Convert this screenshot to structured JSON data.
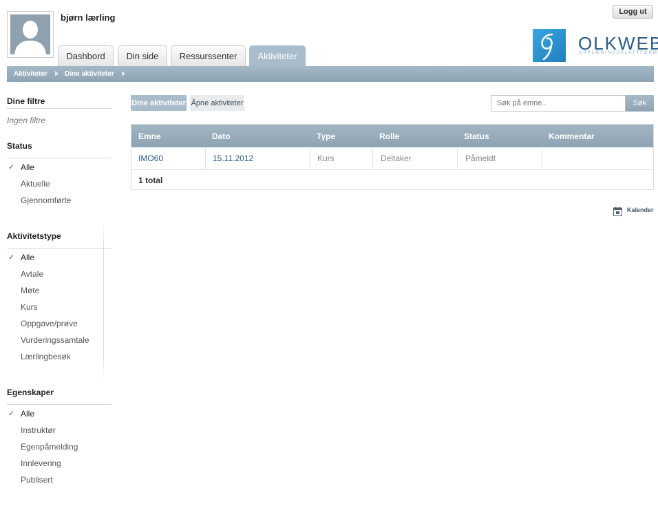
{
  "header": {
    "username": "bjørn lærling",
    "logout_label": "Logg ut",
    "logo_text": "OLKWEB",
    "logo_subtitle": "OPPLÆRINGSPLATTFORM"
  },
  "tabs": [
    {
      "label": "Dashbord"
    },
    {
      "label": "Din side"
    },
    {
      "label": "Ressurssenter"
    },
    {
      "label": "Aktiviteter",
      "active": true
    }
  ],
  "breadcrumb": [
    "Aktiviteter",
    "Dine aktiviteter"
  ],
  "sidebar": {
    "filters_heading": "Dine filtre",
    "no_filters": "Ingen filtre",
    "status": {
      "heading": "Status",
      "items": [
        "Alle",
        "Aktuelle",
        "Gjennomførte"
      ],
      "selected": "Alle"
    },
    "activity_type": {
      "heading": "Aktivitetstype",
      "items": [
        "Alle",
        "Avtale",
        "Møte",
        "Kurs",
        "Oppgave/prøve",
        "Vurderingssamtale",
        "Lærlingbesøk"
      ],
      "selected": "Alle"
    },
    "properties": {
      "heading": "Egenskaper",
      "items": [
        "Alle",
        "Instruktør",
        "Egenpåmelding",
        "Innlevering",
        "Publisert"
      ],
      "selected": "Alle"
    }
  },
  "main": {
    "view_buttons": [
      {
        "label": "Dine aktiviteter",
        "active": true
      },
      {
        "label": "Åpne aktiviteter",
        "active": false
      }
    ],
    "search": {
      "placeholder": "Søk på emne..",
      "button_label": "Søk"
    },
    "table": {
      "columns": [
        "Emne",
        "Dato",
        "Type",
        "Rolle",
        "Status",
        "Kommentar"
      ],
      "rows": [
        [
          "IMO60",
          "15.11.2012",
          "Kurs",
          "Deltaker",
          "Påmeldt",
          ""
        ]
      ],
      "total_label": "1 total"
    },
    "calendar_label": "Kalender"
  },
  "colors": {
    "accent": "#a9bccb",
    "link": "#2a5a86"
  }
}
